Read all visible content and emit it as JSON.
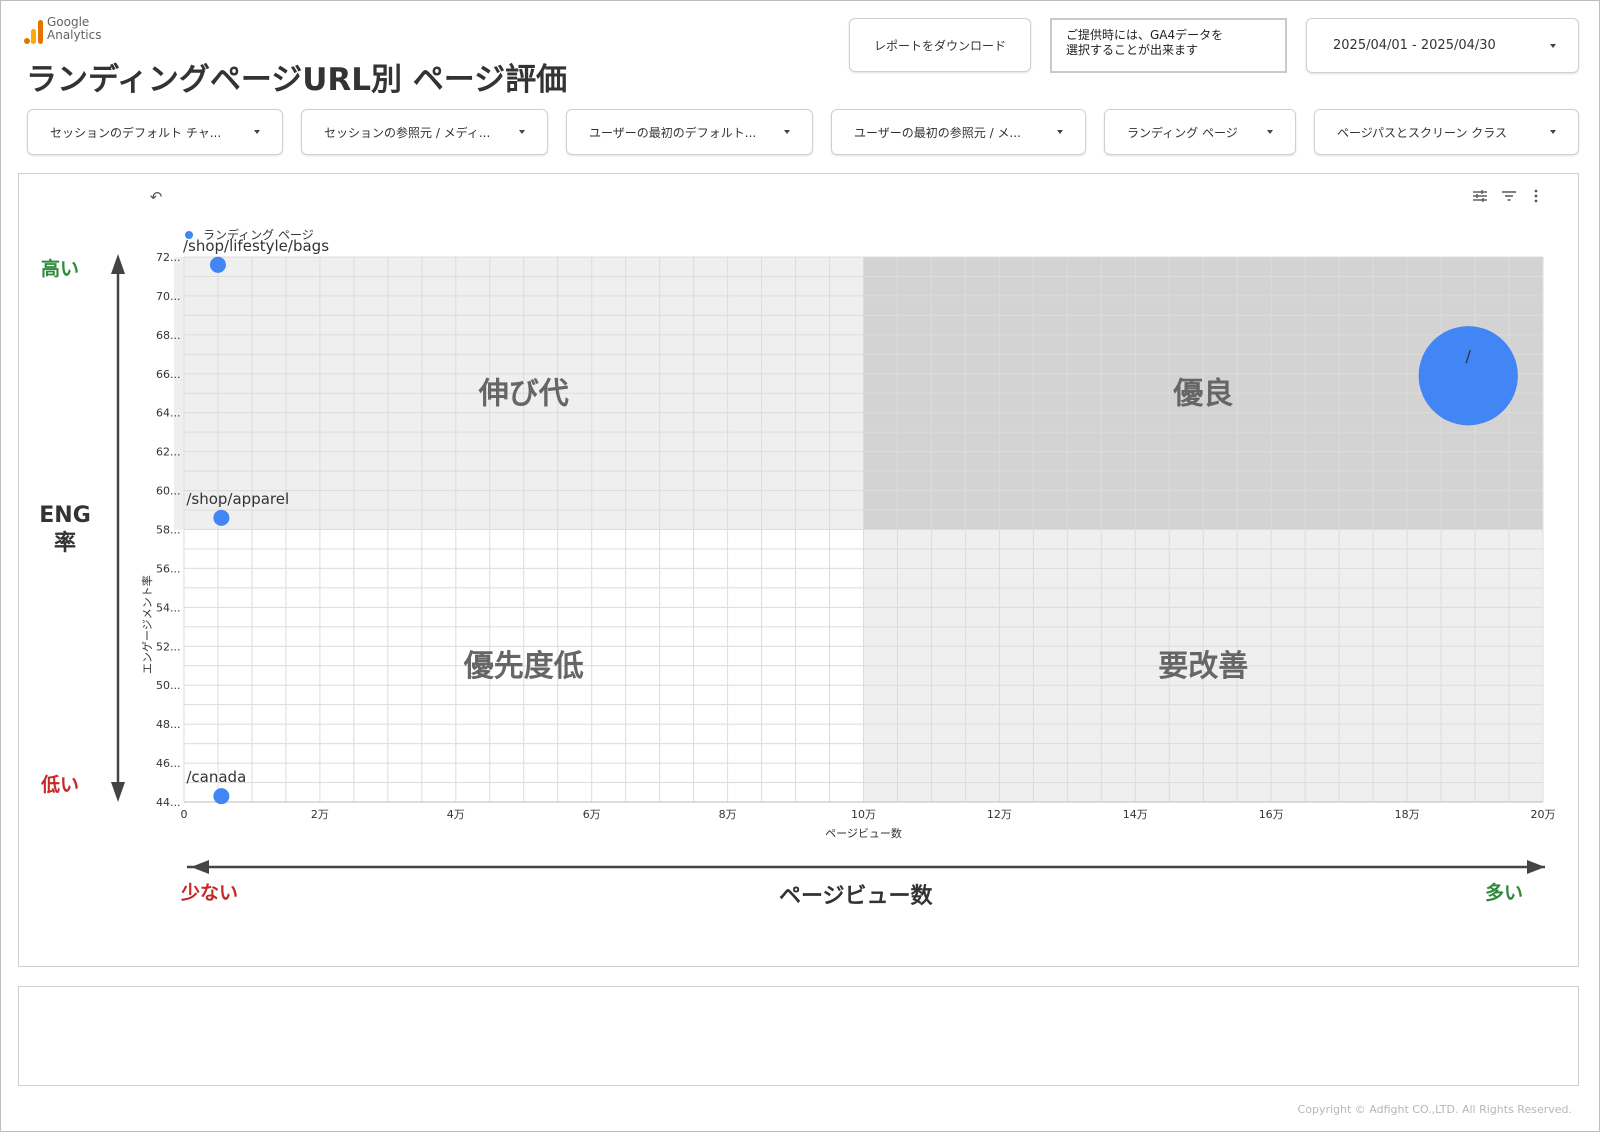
{
  "header": {
    "logo_line1": "Google",
    "logo_line2": "Analytics",
    "title": "ランディングページURL別 ページ評価",
    "download_label": "レポートをダウンロード",
    "note_line1": "ご提供時には、GA4データを",
    "note_line2": "選択することが出来ます",
    "date_range": "2025/04/01 - 2025/04/30"
  },
  "filters": [
    "セッションのデフォルト チャ...",
    "セッションの参照元 / メディ...",
    "ユーザーの最初のデフォルト...",
    "ユーザーの最初の参照元 / メ...",
    "ランディング ページ",
    "ページパスとスクリーン クラス"
  ],
  "toolbar": {
    "undo_icon": "undo-icon",
    "controls_icon": "tune-icon",
    "filter_icon": "filter-icon",
    "more_icon": "more-vert-icon"
  },
  "labels": {
    "high": "高い",
    "low": "低い",
    "eng": "ENG",
    "rate": "率",
    "few": "少ない",
    "many": "多い",
    "pageviews": "ページビュー数"
  },
  "colors": {
    "point": "#4285f4",
    "high_green": "#2e8b3a",
    "low_red": "#c62828",
    "quadrant_good": "#d3d3d3",
    "quadrant_mid": "#efefef"
  },
  "chart_data": {
    "type": "scatter",
    "legend": "ランディング ページ",
    "xlabel": "ページビュー数",
    "ylabel": "エンゲージメント率",
    "xlim": [
      0,
      200000
    ],
    "ylim": [
      44,
      72
    ],
    "x_ticks": [
      "0",
      "2万",
      "4万",
      "6万",
      "8万",
      "10万",
      "12万",
      "14万",
      "16万",
      "18万",
      "20万"
    ],
    "y_ticks": [
      "44...",
      "46...",
      "48...",
      "50...",
      "52...",
      "54...",
      "56...",
      "58...",
      "60...",
      "62...",
      "64...",
      "66...",
      "68...",
      "70...",
      "72..."
    ],
    "thresholds": {
      "x": 100000,
      "y": 58
    },
    "quadrants": [
      {
        "name": "伸び代",
        "pos": "top-left"
      },
      {
        "name": "優良",
        "pos": "top-right"
      },
      {
        "name": "優先度低",
        "pos": "bottom-left"
      },
      {
        "name": "要改善",
        "pos": "bottom-right"
      }
    ],
    "points": [
      {
        "label": "/shop/lifestyle/bags",
        "x": 5000,
        "y": 71.6,
        "size": 1
      },
      {
        "label": "/shop/apparel",
        "x": 5500,
        "y": 58.6,
        "size": 1
      },
      {
        "label": "/canada",
        "x": 5500,
        "y": 44.3,
        "size": 1
      },
      {
        "label": "/",
        "x": 189000,
        "y": 65.9,
        "size": 6.2
      }
    ]
  },
  "footer": {
    "copyright": "Copyright © Adfight CO.,LTD. All Rights Reserved."
  }
}
